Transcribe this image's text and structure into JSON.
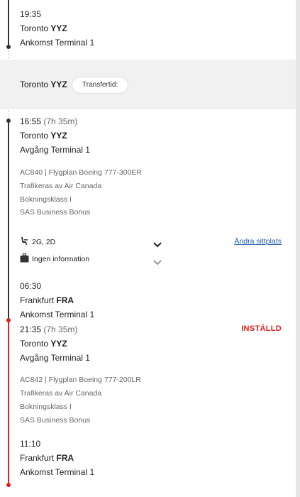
{
  "arrival1": {
    "time": "19:35",
    "city": "Toronto",
    "code": "YYZ",
    "terminal": "Ankomst Terminal 1"
  },
  "transfer": {
    "city": "Toronto",
    "code": "YYZ",
    "label": "Transfertid:"
  },
  "flight1": {
    "time": "16:55",
    "duration": "(7h 35m)",
    "city": "Toronto",
    "code": "YYZ",
    "terminal": "Avgång Terminal 1",
    "info": [
      "AC840 | Flygplan Boeing 777-300ER",
      "Trafikeras av Air Canada",
      "Bokningsklass I",
      "SAS Business Bonus"
    ],
    "seats": "2G, 2D",
    "change_seat": "Ändra sittplats",
    "baggage": "Ingen information",
    "arr_time": "06:30",
    "arr_city": "Frankfurt",
    "arr_code": "FRA",
    "arr_terminal": "Ankomst Terminal 1"
  },
  "flight2": {
    "time": "21:35",
    "duration": "(7h 35m)",
    "status": "INSTÄLLD",
    "city": "Toronto",
    "code": "YYZ",
    "terminal": "Avgång Terminal 1",
    "info": [
      "AC842 | Flygplan Boeing 777-200LR",
      "Trafikeras av Air Canada",
      "Bokningsklass I",
      "SAS Business Bonus"
    ],
    "arr_time": "11:10",
    "arr_city": "Frankfurt",
    "arr_code": "FRA",
    "arr_terminal": "Ankomst Terminal 1"
  },
  "icons": {
    "seat": "seat-icon",
    "baggage": "baggage-icon",
    "chevron": "chevron-down-icon"
  },
  "colors": {
    "cancelled": "#e0201b",
    "link": "#1f5aa6",
    "timeline": "#333333"
  }
}
